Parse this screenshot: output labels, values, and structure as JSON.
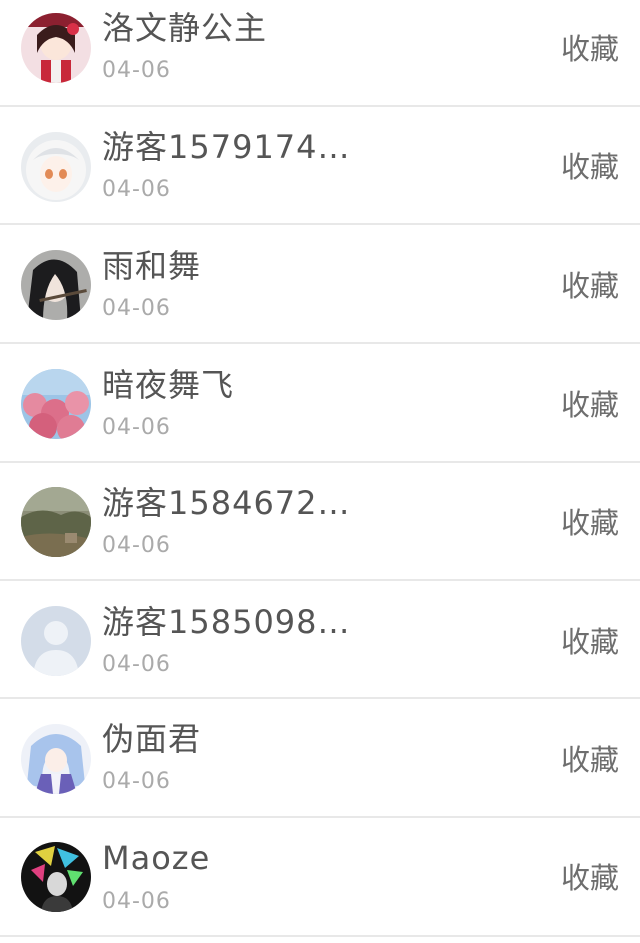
{
  "favorite_label": "收藏",
  "users": [
    {
      "name": "洛文静公主",
      "date": "04-06",
      "avatar": "avatar-shrine-maiden"
    },
    {
      "name": "游客1579174…",
      "date": "04-06",
      "avatar": "avatar-white-hair-girl"
    },
    {
      "name": "雨和舞",
      "date": "04-06",
      "avatar": "avatar-flute-player"
    },
    {
      "name": "暗夜舞飞",
      "date": "04-06",
      "avatar": "avatar-cherry-blossoms"
    },
    {
      "name": "游客1584672…",
      "date": "04-06",
      "avatar": "avatar-landscape"
    },
    {
      "name": "游客1585098…",
      "date": "04-06",
      "avatar": "avatar-default-silhouette"
    },
    {
      "name": "伪面君",
      "date": "04-06",
      "avatar": "avatar-blue-hair-girl"
    },
    {
      "name": "Maoze",
      "date": "04-06",
      "avatar": "avatar-neon-figure"
    }
  ]
}
